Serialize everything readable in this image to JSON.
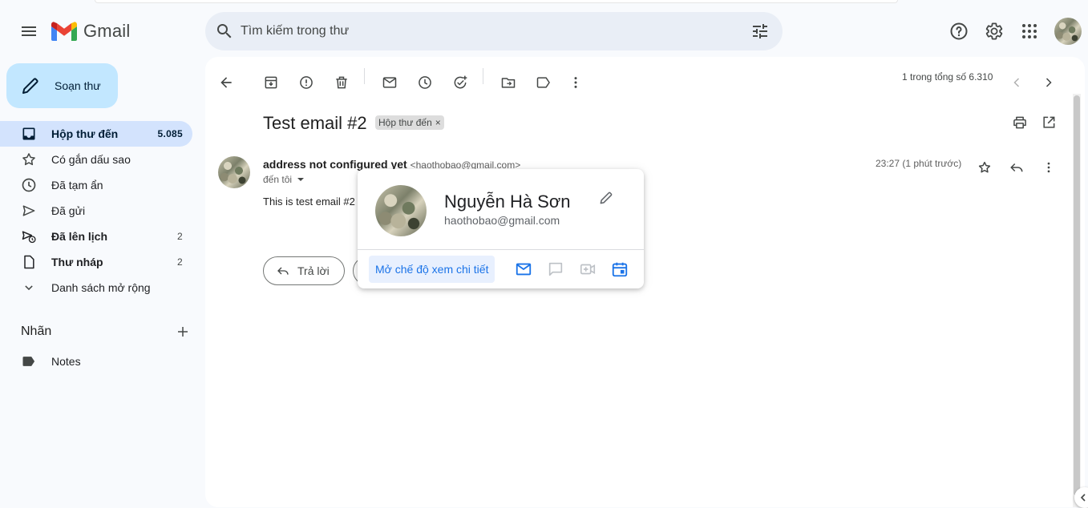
{
  "header": {
    "app_name": "Gmail",
    "search_placeholder": "Tìm kiếm trong thư"
  },
  "sidebar": {
    "compose_label": "Soạn thư",
    "items": [
      {
        "label": "Hộp thư đến",
        "count": "5.085",
        "icon": "inbox-icon"
      },
      {
        "label": "Có gắn dấu sao",
        "count": "",
        "icon": "star-icon"
      },
      {
        "label": "Đã tạm ẩn",
        "count": "",
        "icon": "clock-icon"
      },
      {
        "label": "Đã gửi",
        "count": "",
        "icon": "send-icon"
      },
      {
        "label": "Đã lên lịch",
        "count": "2",
        "icon": "scheduled-send-icon"
      },
      {
        "label": "Thư nháp",
        "count": "2",
        "icon": "draft-icon"
      },
      {
        "label": "Danh sách mở rộng",
        "count": "",
        "icon": "chevron-down-icon"
      }
    ],
    "labels_title": "Nhãn",
    "labels": [
      {
        "label": "Notes",
        "icon": "label-icon"
      }
    ]
  },
  "toolbar": {
    "pager_text": "1 trong tổng số 6.310"
  },
  "email": {
    "subject": "Test email #2",
    "label_chip": "Hộp thư đến",
    "sender_name": "address not configured yet",
    "sender_email": "<haothobao@gmail.com>",
    "to_text": "đến tôi",
    "time": "23:27 (1 phút trước)",
    "body": "This is test email #2",
    "reply_label": "Trả lời"
  },
  "hovercard": {
    "name": "Nguyễn Hà Sơn",
    "email": "haothobao@gmail.com",
    "detail_button": "Mở chế độ xem chi tiết"
  },
  "colors": {
    "accent": "#1a73e8",
    "compose_bg": "#c2e7ff",
    "active_nav": "#d3e3fd",
    "search_bg": "#e9eef6"
  }
}
